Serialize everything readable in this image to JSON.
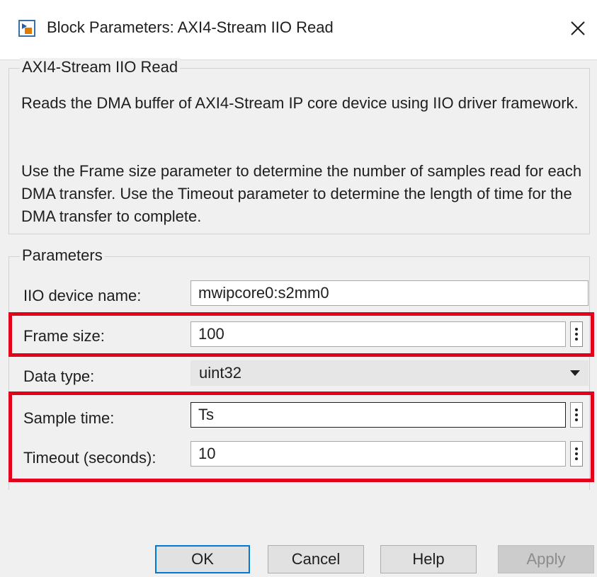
{
  "window": {
    "title": "Block Parameters: AXI4-Stream IIO Read",
    "close_icon": "close-icon",
    "app_icon": "simulink-block-icon"
  },
  "description": {
    "group_title": "AXI4-Stream IIO Read",
    "paragraph1": "Reads the DMA buffer of AXI4-Stream IP core device using IIO driver framework.",
    "paragraph2": "Use the Frame size parameter to determine the number of samples read for each DMA transfer. Use the Timeout parameter to determine the length of time for the DMA transfer to complete."
  },
  "parameters": {
    "group_title": "Parameters",
    "device_name": {
      "label": "IIO device name:",
      "value": "mwipcore0:s2mm0"
    },
    "frame_size": {
      "label": "Frame size:",
      "value": "100"
    },
    "data_type": {
      "label": "Data type:",
      "value": "uint32"
    },
    "sample_time": {
      "label": "Sample time:",
      "value": "Ts"
    },
    "timeout": {
      "label": "Timeout (seconds):",
      "value": "10"
    }
  },
  "buttons": {
    "ok": "OK",
    "cancel": "Cancel",
    "help": "Help",
    "apply": "Apply"
  },
  "colors": {
    "highlight": "#e3001b",
    "default_button_border": "#0078d7"
  }
}
